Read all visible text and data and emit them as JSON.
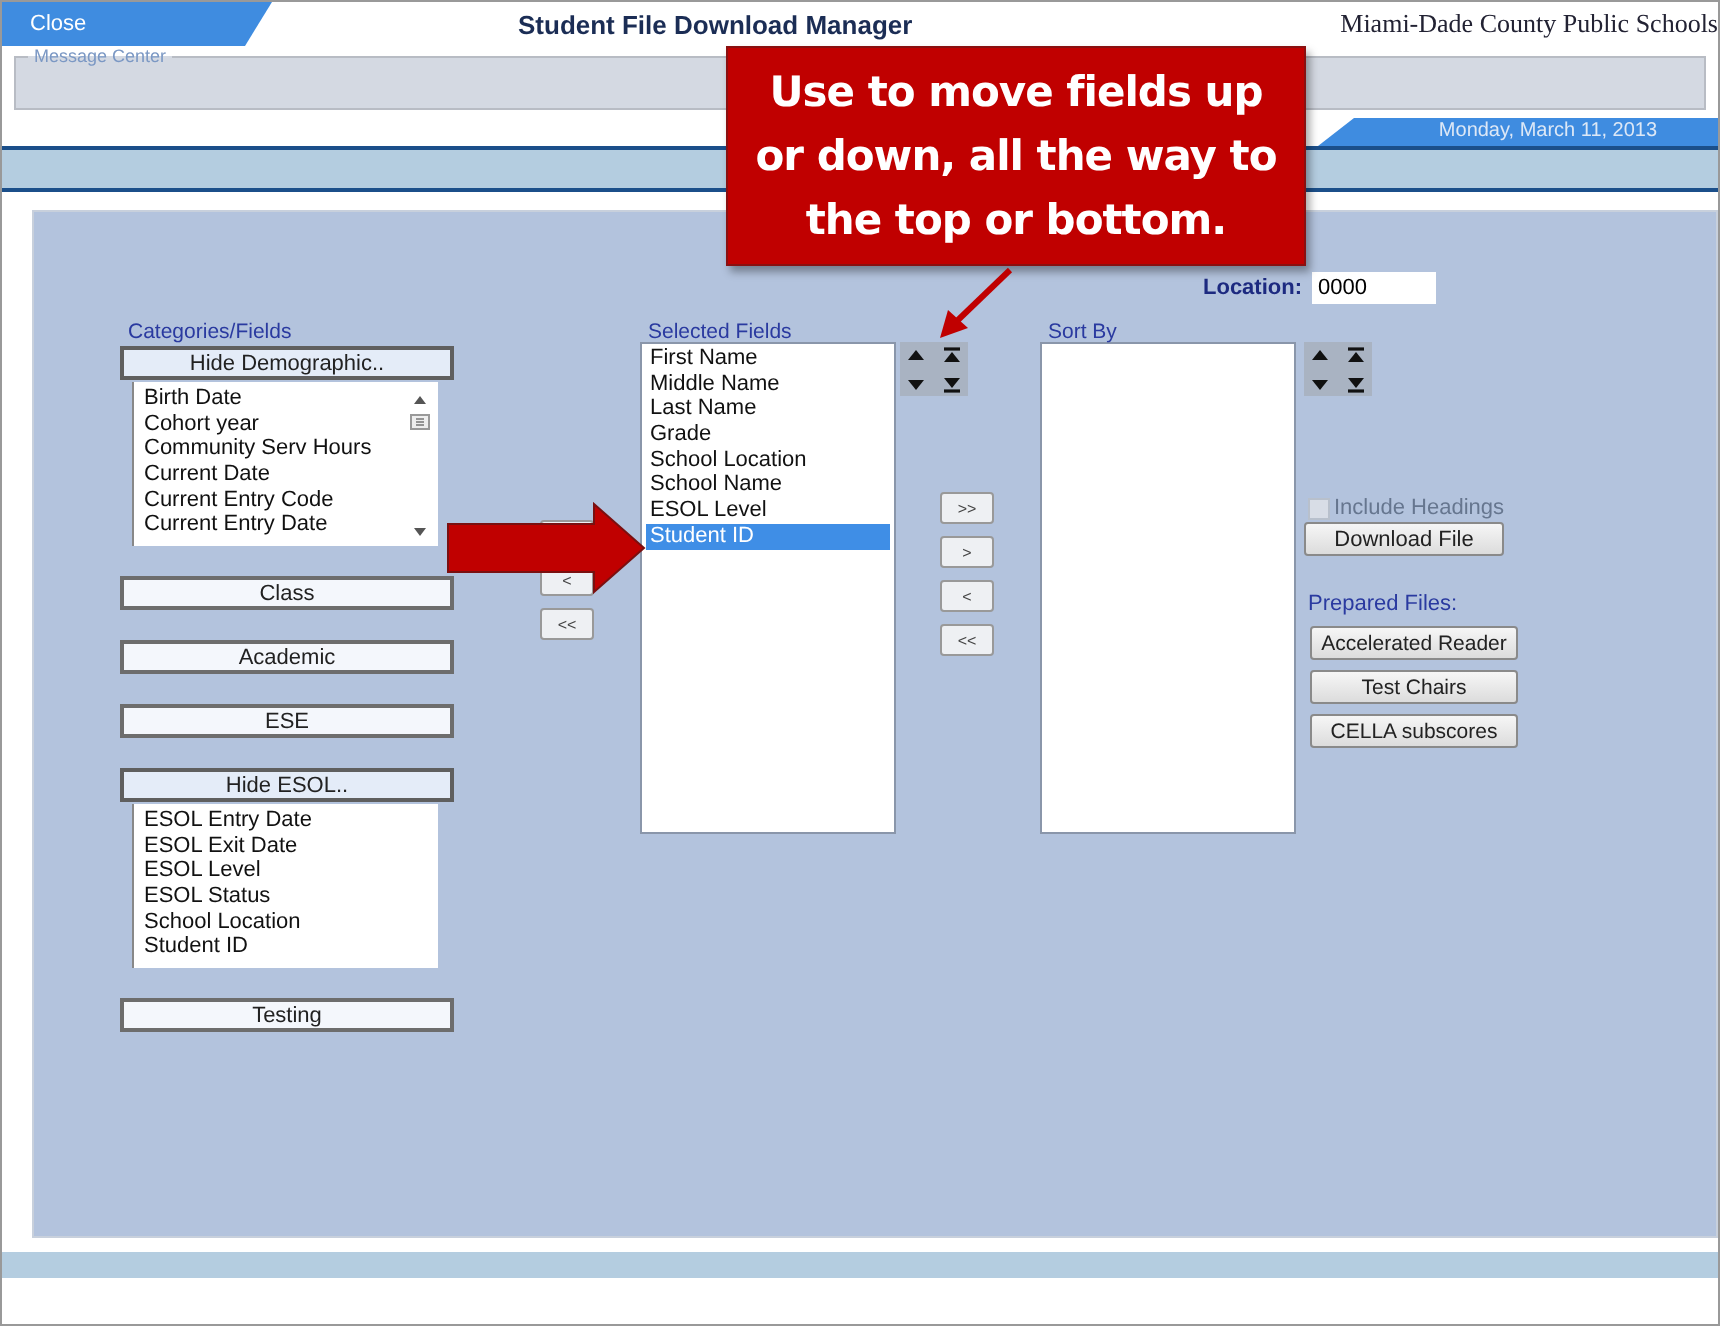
{
  "header": {
    "close": "Close",
    "title": "Student File Download Manager",
    "organization": "Miami-Dade County Public Schools"
  },
  "message_center": {
    "legend": "Message Center"
  },
  "date": "Monday, March 11, 2013",
  "location": {
    "label": "Location:",
    "value": "0000"
  },
  "categories": {
    "label": "Categories/Fields",
    "groups": [
      {
        "label": "Hide Demographic..",
        "expanded": true,
        "scrollable": true,
        "items": [
          {
            "label": "Birth Date",
            "selected": false
          },
          {
            "label": "Cohort year",
            "selected": false
          },
          {
            "label": "Community Serv Hours",
            "selected": false
          },
          {
            "label": "Current Date",
            "selected": false
          },
          {
            "label": "Current Entry Code",
            "selected": false
          },
          {
            "label": "Current Entry Date",
            "selected": false
          }
        ]
      },
      {
        "label": "Class",
        "expanded": false
      },
      {
        "label": "Academic",
        "expanded": false
      },
      {
        "label": "ESE",
        "expanded": false
      },
      {
        "label": "Hide ESOL..",
        "expanded": true,
        "items": [
          {
            "label": "ESOL Entry Date",
            "selected": false
          },
          {
            "label": "ESOL Exit Date",
            "selected": false
          },
          {
            "label": "ESOL Level",
            "selected": false
          },
          {
            "label": "ESOL Status",
            "selected": false
          },
          {
            "label": "School Location",
            "selected": false
          },
          {
            "label": "Student ID",
            "selected": false
          }
        ]
      },
      {
        "label": "Testing",
        "expanded": false
      }
    ]
  },
  "left_transfer_buttons": [
    {
      "kind": "blank"
    },
    {
      "kind": "label",
      "label": "<"
    },
    {
      "kind": "label",
      "label": "<<"
    }
  ],
  "selected_fields": {
    "label": "Selected Fields",
    "items": [
      {
        "label": "First Name",
        "selected": false
      },
      {
        "label": "Middle Name",
        "selected": false
      },
      {
        "label": "Last Name",
        "selected": false
      },
      {
        "label": "Grade",
        "selected": false
      },
      {
        "label": "School Location",
        "selected": false
      },
      {
        "label": "School Name",
        "selected": false
      },
      {
        "label": "ESOL Level",
        "selected": false
      },
      {
        "label": "Student ID",
        "selected": true
      }
    ]
  },
  "transfer_buttons": [
    ">>",
    ">",
    "<",
    "<<"
  ],
  "sort_by": {
    "label": "Sort By"
  },
  "include_headings": {
    "label": "Include Headings",
    "checked": false,
    "disabled": true
  },
  "download_button": "Download File",
  "prepared_files": {
    "label": "Prepared Files:",
    "buttons": [
      "Accelerated Reader",
      "Test Chairs",
      "CELLA subscores"
    ]
  },
  "callout": {
    "text": "Use to move fields up or down, all the way to the top or bottom."
  }
}
